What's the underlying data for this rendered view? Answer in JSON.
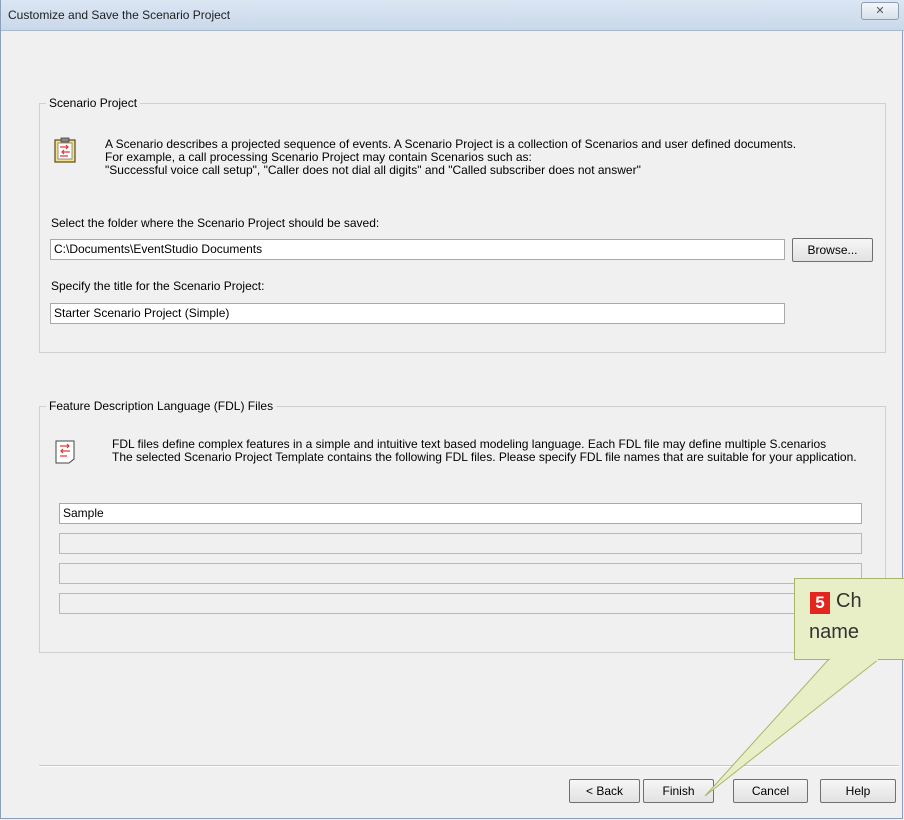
{
  "window": {
    "title": "Customize and Save the Scenario Project",
    "close_glyph": "✕"
  },
  "scenario_project": {
    "legend": "Scenario Project",
    "description_line1": "A Scenario describes a projected sequence of events. A Scenario Project is a collection of Scenarios and user defined documents.",
    "description_line2": "For example, a call processing Scenario Project may contain Scenarios such as:",
    "description_line3": "\"Successful voice call setup\", \"Caller does not dial all digits\" and \"Called subscriber does not answer\"",
    "folder_label": "Select the folder where the Scenario Project should be saved:",
    "folder_value": "C:\\Documents\\EventStudio Documents",
    "browse_label": "Browse...",
    "title_label": "Specify the title for the Scenario Project:",
    "title_value": "Starter Scenario Project (Simple)",
    "icon": "clipboard-icon"
  },
  "fdl": {
    "legend": "Feature Description Language (FDL) Files",
    "description_line1": "FDL files define complex features in a simple and intuitive text based modeling language. Each FDL file may define multiple S.cenarios",
    "description_line2": "The selected Scenario Project Template contains the following FDL files. Please specify FDL file names that are suitable for your application.",
    "files": [
      "Sample",
      "",
      "",
      ""
    ],
    "icon": "fdl-document-icon"
  },
  "buttons": {
    "back": "< Back",
    "finish": "Finish",
    "cancel": "Cancel",
    "help": "Help"
  },
  "callout": {
    "step": "5",
    "line1": "Ch",
    "line2": "name"
  },
  "colors": {
    "callout_fill": "#e8efc6",
    "callout_border": "#a9b56a",
    "step_badge": "#e2251f"
  }
}
